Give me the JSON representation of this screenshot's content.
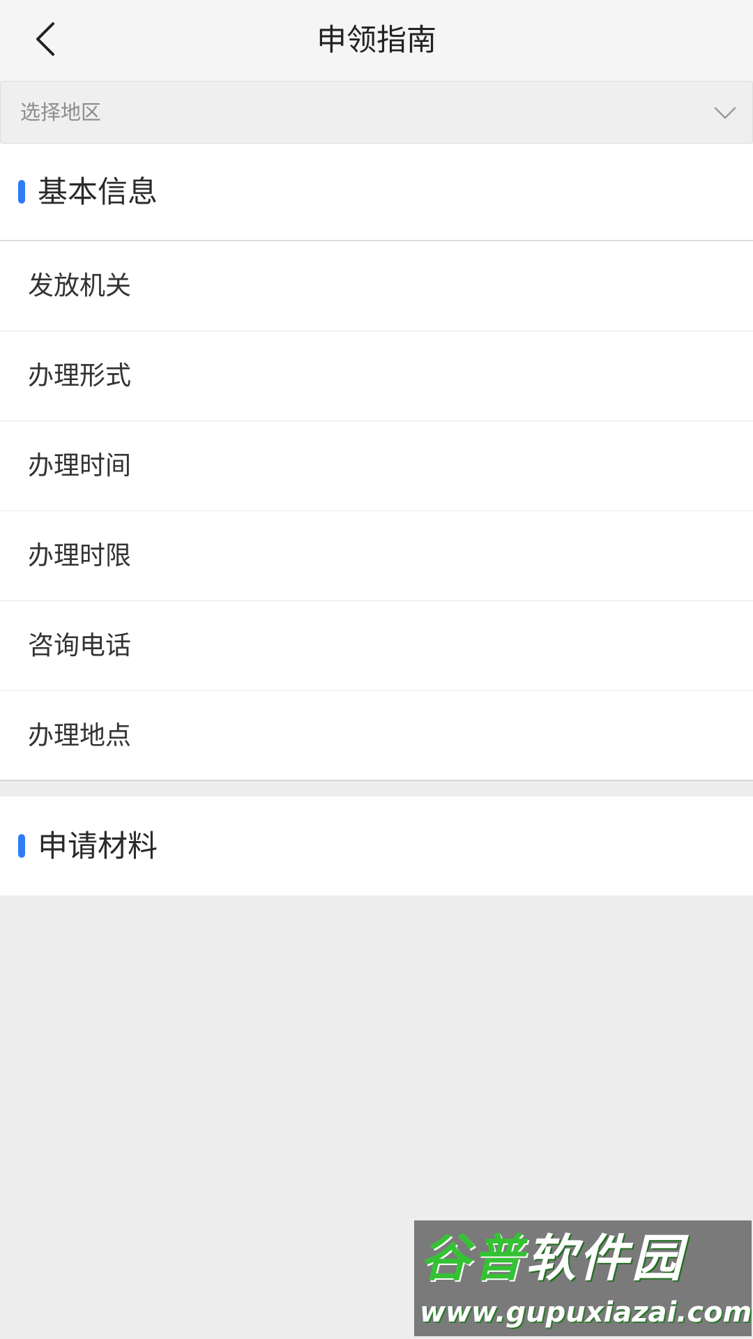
{
  "navbar": {
    "title": "申领指南",
    "back_icon": "chevron-left-icon"
  },
  "region": {
    "placeholder": "选择地区",
    "chevron_icon": "chevron-down-icon"
  },
  "sections": [
    {
      "title": "基本信息",
      "accent_color": "#2f7cf6",
      "items": [
        {
          "label": "发放机关"
        },
        {
          "label": "办理形式"
        },
        {
          "label": "办理时间"
        },
        {
          "label": "办理时限"
        },
        {
          "label": "咨询电话"
        },
        {
          "label": "办理地点"
        }
      ]
    },
    {
      "title": "申请材料",
      "accent_color": "#2f7cf6"
    }
  ],
  "watermark": {
    "brand_green": "谷普",
    "brand_white": "软件园",
    "url": "www.gupuxiazai.com"
  }
}
